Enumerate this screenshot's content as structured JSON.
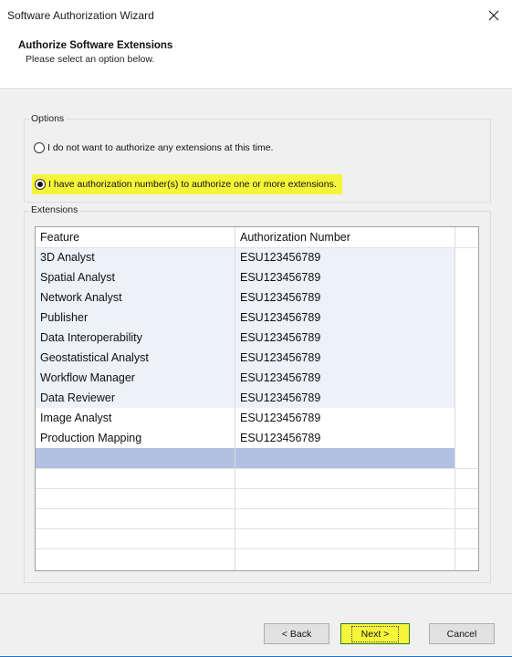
{
  "window": {
    "title": "Software Authorization Wizard"
  },
  "header": {
    "title": "Authorize Software Extensions",
    "subtitle": "Please select an option below."
  },
  "options": {
    "group_label": "Options",
    "choices": [
      {
        "label": "I do not want to authorize any extensions at this time.",
        "selected": false
      },
      {
        "label": "I have authorization number(s) to authorize one or more extensions.",
        "selected": true
      }
    ],
    "highlight_color": "#f5f53a"
  },
  "extensions": {
    "group_label": "Extensions",
    "columns": [
      "Feature",
      "Authorization Number"
    ],
    "rows": [
      [
        "3D Analyst",
        "ESU123456789"
      ],
      [
        "Spatial Analyst",
        "ESU123456789"
      ],
      [
        "Network Analyst",
        "ESU123456789"
      ],
      [
        "Publisher",
        "ESU123456789"
      ],
      [
        "Data Interoperability",
        "ESU123456789"
      ],
      [
        "Geostatistical Analyst",
        "ESU123456789"
      ],
      [
        "Workflow Manager",
        "ESU123456789"
      ],
      [
        "Data Reviewer",
        "ESU123456789"
      ],
      [
        "Image Analyst",
        "ESU123456789"
      ],
      [
        "Production Mapping",
        "ESU123456789"
      ]
    ],
    "selected_row_color": "#b2c0e2"
  },
  "buttons": {
    "back": "< Back",
    "next": "Next >",
    "cancel": "Cancel"
  }
}
